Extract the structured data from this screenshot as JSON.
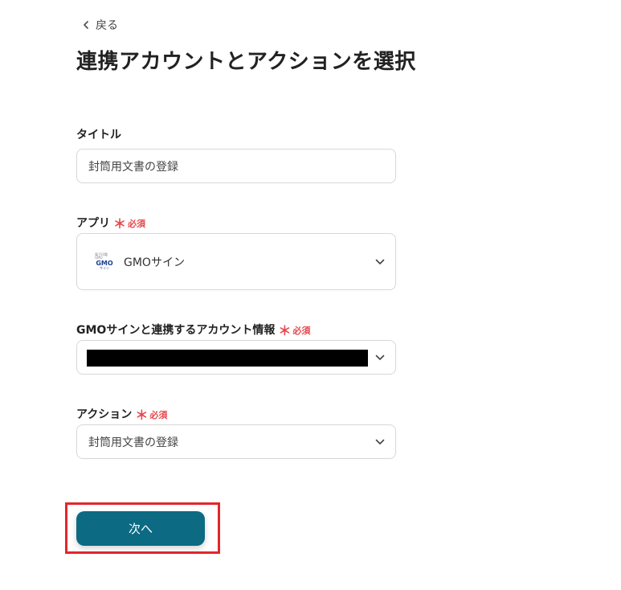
{
  "nav": {
    "back_label": "戻る"
  },
  "page": {
    "title": "連携アカウントとアクションを選択"
  },
  "form": {
    "title_field": {
      "label": "タイトル",
      "value": "封筒用文書の登録"
    },
    "app_field": {
      "label": "アプリ",
      "required_mark": "＊",
      "required_label": "必須",
      "selected_app": "GMOサイン",
      "logo": {
        "line1": "電子印鑑GMO",
        "line2": "GMO",
        "line3": "サイン"
      }
    },
    "account_field": {
      "label": "GMOサインと連携するアカウント情報",
      "required_mark": "＊",
      "required_label": "必須"
    },
    "action_field": {
      "label": "アクション",
      "required_mark": "＊",
      "required_label": "必須",
      "selected_action": "封筒用文書の登録"
    }
  },
  "buttons": {
    "next_label": "次へ"
  },
  "colors": {
    "primary": "#0c6a82",
    "required": "#e5484d",
    "highlight": "#e3262c"
  }
}
